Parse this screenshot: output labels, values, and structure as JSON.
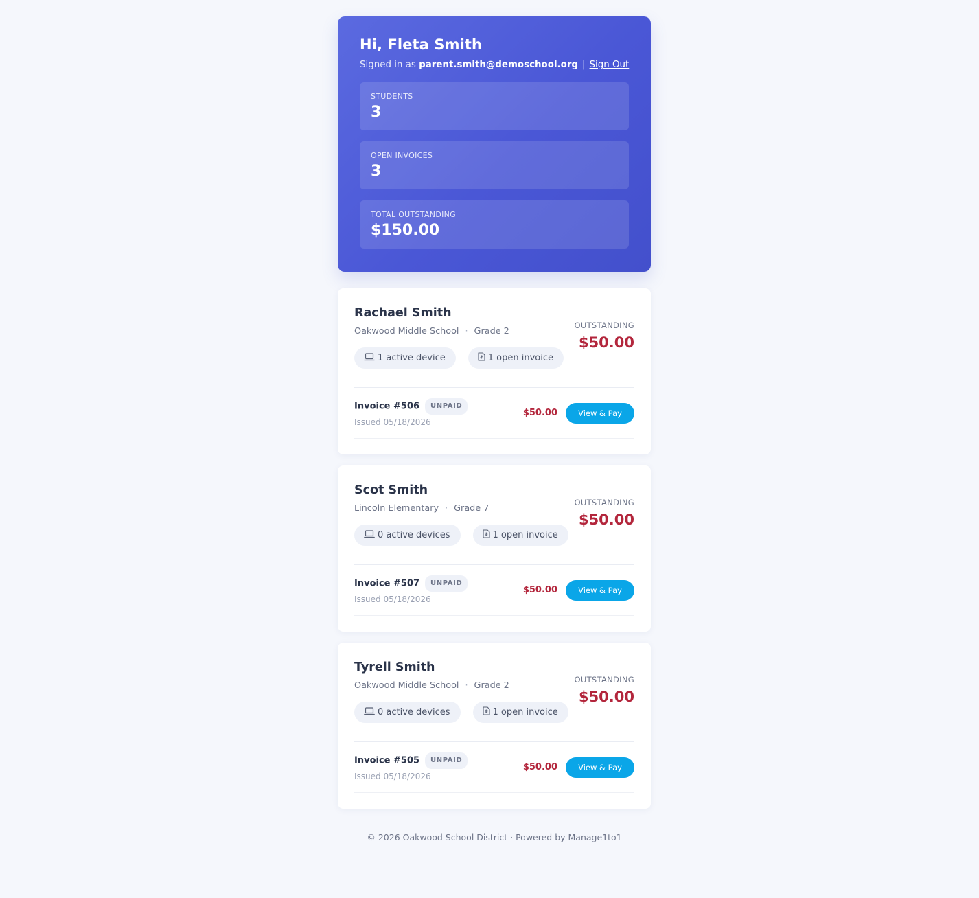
{
  "header": {
    "greeting": "Hi, Fleta Smith",
    "signed_in_prefix": "Signed in as",
    "email": "parent.smith@demoschool.org",
    "separator": "|",
    "sign_out_label": "Sign Out"
  },
  "stats": [
    {
      "label": "Students",
      "value": "3"
    },
    {
      "label": "Open Invoices",
      "value": "3"
    },
    {
      "label": "Total Outstanding",
      "value": "$150.00"
    }
  ],
  "students": [
    {
      "name": "Rachael Smith",
      "school": "Oakwood Middle School",
      "dot": "·",
      "grade": "Grade 2",
      "devices_label": "1 active device",
      "invoices_label": "1 open invoice",
      "outstanding_label": "OUTSTANDING",
      "outstanding_amount": "$50.00",
      "invoice": {
        "title": "Invoice #506",
        "status": "UNPAID",
        "issued": "Issued 05/18/2026",
        "amount": "$50.00",
        "action_label": "View & Pay"
      }
    },
    {
      "name": "Scot Smith",
      "school": "Lincoln Elementary",
      "dot": "·",
      "grade": "Grade 7",
      "devices_label": "0 active devices",
      "invoices_label": "1 open invoice",
      "outstanding_label": "OUTSTANDING",
      "outstanding_amount": "$50.00",
      "invoice": {
        "title": "Invoice #507",
        "status": "UNPAID",
        "issued": "Issued 05/18/2026",
        "amount": "$50.00",
        "action_label": "View & Pay"
      }
    },
    {
      "name": "Tyrell Smith",
      "school": "Oakwood Middle School",
      "dot": "·",
      "grade": "Grade 2",
      "devices_label": "0 active devices",
      "invoices_label": "1 open invoice",
      "outstanding_label": "OUTSTANDING",
      "outstanding_amount": "$50.00",
      "invoice": {
        "title": "Invoice #505",
        "status": "UNPAID",
        "issued": "Issued 05/18/2026",
        "amount": "$50.00",
        "action_label": "View & Pay"
      }
    }
  ],
  "icons": {
    "device": "laptop-icon",
    "invoice": "invoice-document-icon"
  },
  "colors": {
    "accent": "#4f5ddb",
    "outstanding": "#b3263c",
    "button": "#0aa6e8"
  },
  "footer": {
    "text": "© 2026 Oakwood School District · Powered by Manage1to1"
  }
}
